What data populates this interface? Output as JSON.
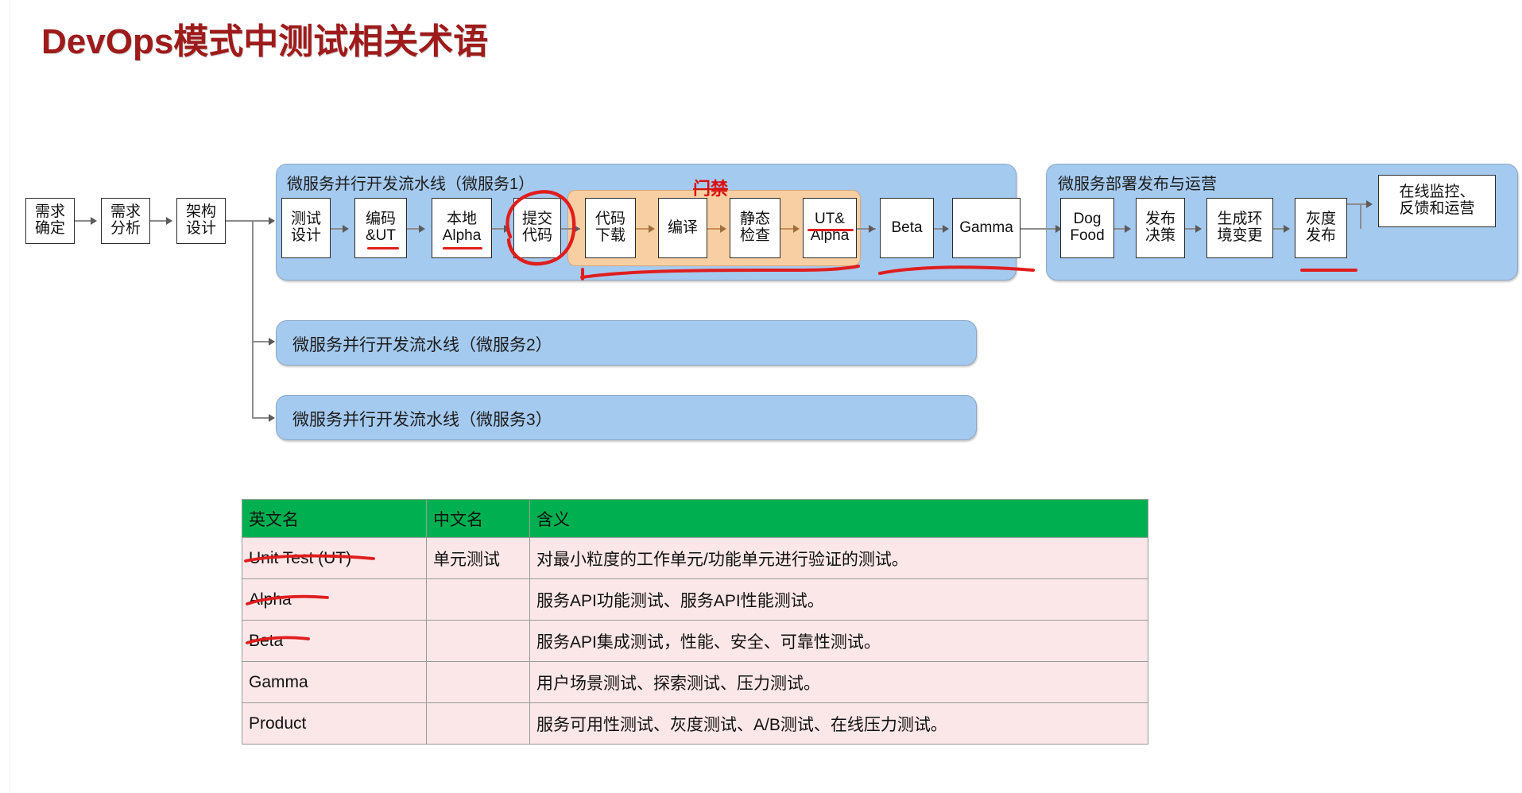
{
  "slide": {
    "title": "DevOps模式中测试相关术语",
    "title_color": "#9e1b1b",
    "background": "#ffffff"
  },
  "upstream_nodes": [
    {
      "label": "需求\n确定"
    },
    {
      "label": "需求\n分析"
    },
    {
      "label": "架构\n设计"
    }
  ],
  "pipelines": [
    {
      "name": "microservice-1",
      "title": "微服务并行开发流水线（微服务1）",
      "color": "#a5caf0",
      "nodes": [
        {
          "label": "测试\n设计"
        },
        {
          "label": "编码\n&UT"
        },
        {
          "label": "本地\nAlpha"
        },
        {
          "label": "提交\n代码"
        },
        {
          "label": "代码\n下载"
        },
        {
          "label": "编译"
        },
        {
          "label": "静态\n检查"
        },
        {
          "label": "UT&\nAlpha"
        },
        {
          "label": "Beta"
        },
        {
          "label": "Gamma"
        }
      ],
      "gate_group": {
        "label": "门禁",
        "color": "#f8cfa3",
        "members": [
          "代码\n下载",
          "编译",
          "静态\n检查",
          "UT&\nAlpha"
        ]
      }
    },
    {
      "name": "microservice-2",
      "title": "微服务并行开发流水线（微服务2）",
      "color": "#a5caf0",
      "nodes": []
    },
    {
      "name": "microservice-3",
      "title": "微服务并行开发流水线（微服务3）",
      "color": "#a5caf0",
      "nodes": []
    },
    {
      "name": "deploy-release-ops",
      "title": "微服务部署发布与运营",
      "color": "#a5caf0",
      "nodes": [
        {
          "label": "Dog\nFood"
        },
        {
          "label": "发布\n决策"
        },
        {
          "label": "生成环\n境变更"
        },
        {
          "label": "灰度\n发布"
        }
      ]
    }
  ],
  "tail_node": {
    "label": "在线监控、\n反馈和运营"
  },
  "annotations": {
    "gate_label": "门禁",
    "gate_label_color": "#d81111",
    "ink_color": "#e01d1d",
    "marks": [
      {
        "kind": "underline",
        "target": "编码&UT"
      },
      {
        "kind": "underline",
        "target": "本地Alpha"
      },
      {
        "kind": "circle",
        "target": "提交代码"
      },
      {
        "kind": "underline",
        "target": "UT&Alpha"
      },
      {
        "kind": "underline",
        "target": "门禁组"
      },
      {
        "kind": "underline",
        "target": "Beta-Gamma"
      },
      {
        "kind": "underline",
        "target": "灰度发布"
      },
      {
        "kind": "underline",
        "target": "Unit Test (UT)"
      },
      {
        "kind": "underline",
        "target": "Alpha"
      },
      {
        "kind": "underline",
        "target": "Beta"
      }
    ]
  },
  "table": {
    "header_color": "#00b050",
    "row_color": "#fbe7e7",
    "columns": [
      "英文名",
      "中文名",
      "含义"
    ],
    "rows": [
      {
        "en": "Unit Test (UT)",
        "cn": "单元测试",
        "meaning": "对最小粒度的工作单元/功能单元进行验证的测试。"
      },
      {
        "en": "Alpha",
        "cn": "",
        "meaning": "服务API功能测试、服务API性能测试。"
      },
      {
        "en": "Beta",
        "cn": "",
        "meaning": "服务API集成测试，性能、安全、可靠性测试。"
      },
      {
        "en": "Gamma",
        "cn": "",
        "meaning": "用户场景测试、探索测试、压力测试。"
      },
      {
        "en": "Product",
        "cn": "",
        "meaning": "服务可用性测试、灰度测试、A/B测试、在线压力测试。"
      }
    ]
  }
}
